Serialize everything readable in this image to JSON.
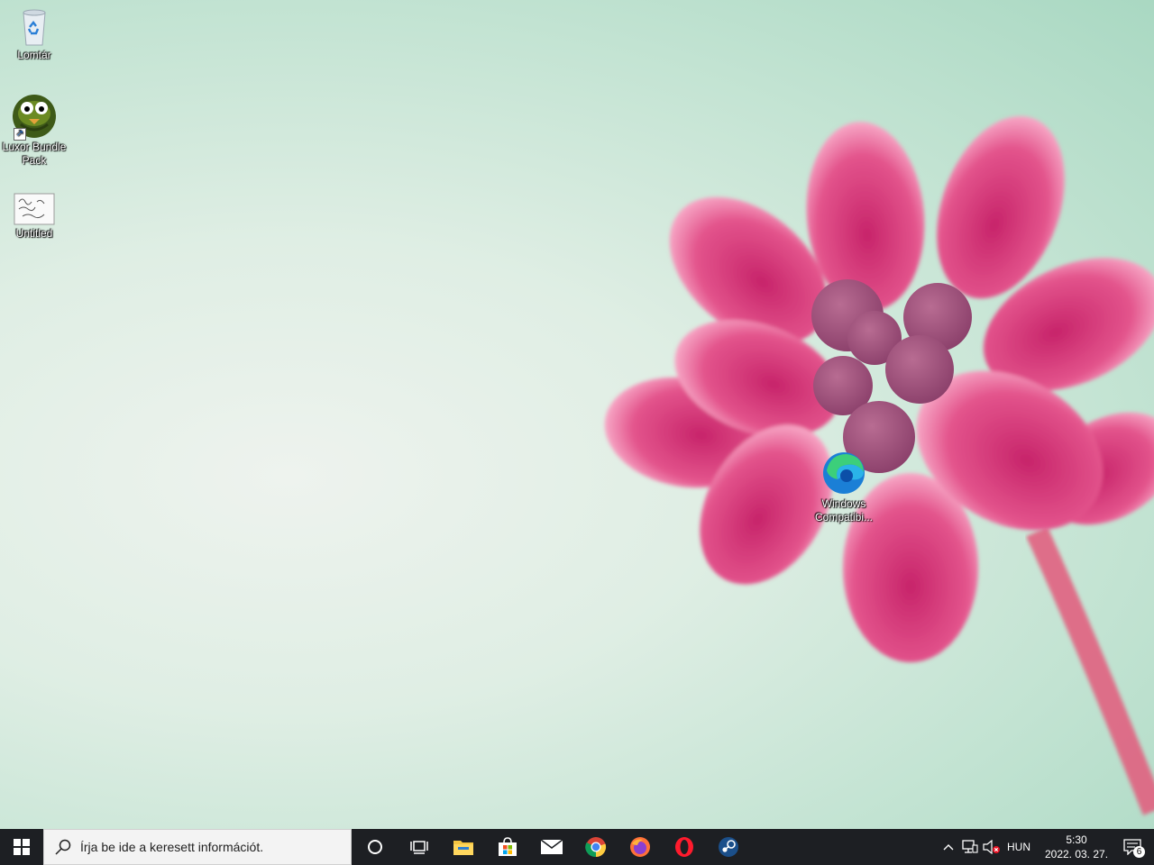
{
  "desktop": {
    "icons": [
      {
        "label": "Lomtár",
        "icon": "recycle-bin-icon"
      },
      {
        "label": "Luxor Bundle Pack",
        "icon": "luxor-game-icon"
      },
      {
        "label": "Untitled",
        "icon": "image-file-icon"
      },
      {
        "label": "Windows Compatibi...",
        "icon": "edge-icon"
      }
    ]
  },
  "taskbar": {
    "search_placeholder": "Írja be ide a keresett információt.",
    "pinned_apps": [
      "file-explorer",
      "microsoft-store",
      "mail",
      "chrome",
      "firefox",
      "opera",
      "steam"
    ],
    "language": "HUN",
    "time": "5:30",
    "date": "2022. 03. 27.",
    "notification_count": "6"
  },
  "colors": {
    "taskbar_bg": "#1d1f23",
    "flower": "#e0457f",
    "wallpaper_accent": "#a9d8c2"
  }
}
